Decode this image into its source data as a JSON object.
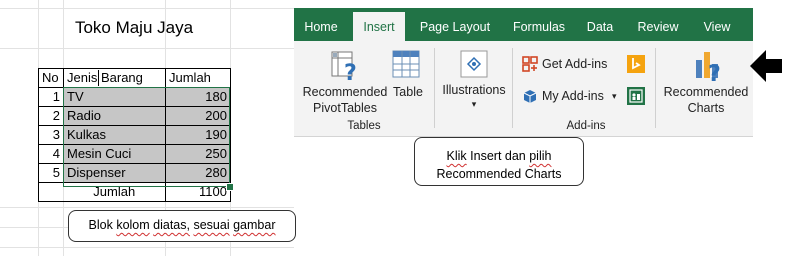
{
  "sheet": {
    "title": "Toko Maju Jaya",
    "headers": {
      "no": "No",
      "name": "Jenis Barang",
      "amount": "Jumlah"
    },
    "rows": [
      {
        "no": "1",
        "name": "TV",
        "amount": "180"
      },
      {
        "no": "2",
        "name": "Radio",
        "amount": "200"
      },
      {
        "no": "3",
        "name": "Kulkas",
        "amount": "190"
      },
      {
        "no": "4",
        "name": "Mesin Cuci",
        "amount": "250"
      },
      {
        "no": "5",
        "name": "Dispenser",
        "amount": "280"
      }
    ],
    "total_label": "Jumlah",
    "total_value": "1100"
  },
  "ribbon": {
    "tabs": [
      "Home",
      "Insert",
      "Page Layout",
      "Formulas",
      "Data",
      "Review",
      "View"
    ],
    "active_tab": "Insert",
    "tables_group": {
      "label": "Tables",
      "recommended_pivot_line1": "Recommended",
      "recommended_pivot_line2": "PivotTables",
      "table": "Table"
    },
    "illustrations": "Illustrations",
    "addins_group": {
      "label": "Add-ins",
      "get_addins": "Get Add-ins",
      "my_addins": "My Add-ins"
    },
    "charts": {
      "line1": "Recommended",
      "line2": "Charts"
    },
    "colors": {
      "accent": "#217346",
      "tab_bar": "#217346",
      "ribbon_bg": "#f3f3f3",
      "selection": "#c6c6c6"
    }
  },
  "callouts": {
    "insert": {
      "line1_words": [
        "Klik",
        "Insert dan",
        "pilih"
      ],
      "line2": "Recommended Charts"
    },
    "block": {
      "words": [
        "Blok",
        "kolom",
        "diatas,",
        "sesuai",
        "gambar"
      ]
    }
  },
  "icons": [
    "pivot-table-icon",
    "table-icon",
    "illustrations-icon",
    "store-icon",
    "bing-icon",
    "my-addins-icon",
    "people-graph-icon",
    "dropdown-arrow-icon",
    "recommended-charts-icon",
    "pointer-arrow-icon"
  ]
}
